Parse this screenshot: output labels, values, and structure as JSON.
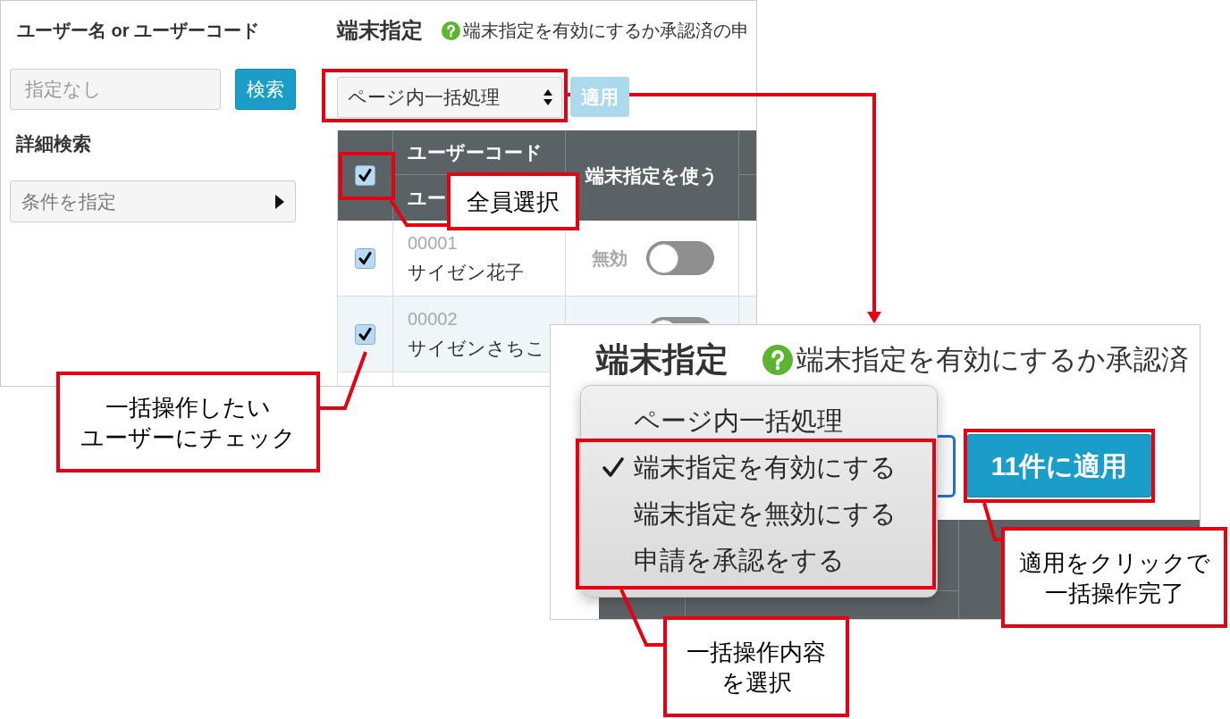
{
  "main_screen": {
    "search": {
      "label": "ユーザー名 or ユーザーコード",
      "placeholder": "指定なし",
      "search_button": "検索",
      "advanced_label": "詳細検索",
      "advanced_dropdown": "条件を指定"
    },
    "device_setting": {
      "title": "端末指定",
      "help_text": "端末指定を有効にするか承認済の申",
      "bulk_action_select": "ページ内一括処理",
      "apply_button": {
        "label": "適用",
        "disabled": true
      }
    },
    "table": {
      "select_all": {
        "checked": true
      },
      "header_user_code": "ユーザーコード",
      "header_user_name": "ユー",
      "header_device": "端末指定を使う",
      "rows": [
        {
          "checked": true,
          "code": "00001",
          "name": "サイゼン花子",
          "status": "無効",
          "on": false
        },
        {
          "checked": true,
          "code": "00002",
          "name": "サイゼンさちこ",
          "on": false
        }
      ]
    }
  },
  "zoomed_view": {
    "title": "端末指定",
    "help_text": "端末指定を有効にするか承認済",
    "apply_button": {
      "label": "11件に適用",
      "disabled": false
    },
    "menu": [
      {
        "label": "ページ内一括処理",
        "selected": false
      },
      {
        "label": "端末指定を有効にする",
        "selected": true
      },
      {
        "label": "端末指定を無効にする",
        "selected": false
      },
      {
        "label": "申請を承認をする",
        "selected": false
      }
    ]
  },
  "annotations": [
    {
      "kind": "callout",
      "lines": [
        "全員選択"
      ]
    },
    {
      "kind": "callout",
      "lines": [
        "一括操作したい",
        "ユーザーにチェック"
      ]
    },
    {
      "kind": "callout",
      "lines": [
        "適用をクリックで",
        "一括操作完了"
      ]
    },
    {
      "kind": "callout",
      "lines": [
        "一括操作内容",
        "を選択"
      ]
    }
  ]
}
